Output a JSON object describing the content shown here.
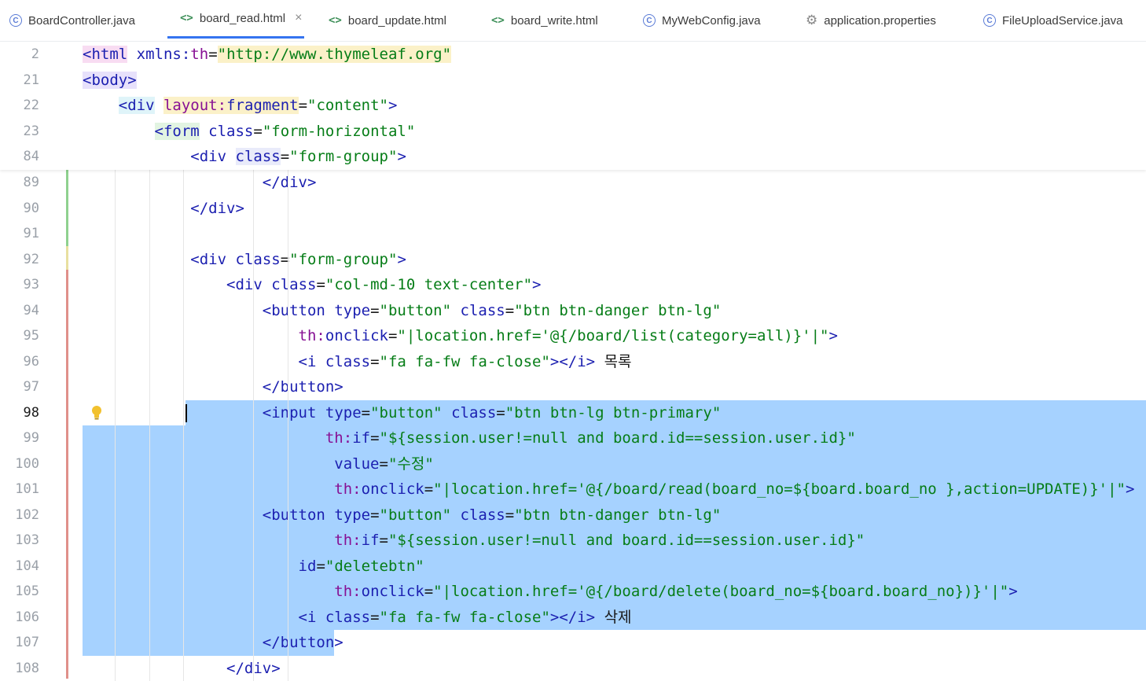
{
  "tabs": [
    {
      "label": "BoardController.java",
      "icon": "class-icon"
    },
    {
      "label": "board_read.html",
      "icon": "html-icon",
      "active": true
    },
    {
      "label": "board_update.html",
      "icon": "html-icon"
    },
    {
      "label": "board_write.html",
      "icon": "html-icon"
    },
    {
      "label": "MyWebConfig.java",
      "icon": "class-icon"
    },
    {
      "label": "application.properties",
      "icon": "gear-icon"
    },
    {
      "label": "FileUploadService.java",
      "icon": "class-icon"
    }
  ],
  "tab_close": "×",
  "sticky_lines": [
    {
      "num": "2",
      "text": "<html xmlns:th=\"http://www.thymeleaf.org\""
    },
    {
      "num": "21",
      "text": "<body>"
    },
    {
      "num": "22",
      "text": "    <div layout:fragment=\"content\">"
    },
    {
      "num": "23",
      "text": "        <form class=\"form-horizontal\""
    },
    {
      "num": "84",
      "text": "            <div class=\"form-group\">"
    }
  ],
  "lines": [
    {
      "num": "89",
      "text": "                    </div>"
    },
    {
      "num": "90",
      "text": "            </div>"
    },
    {
      "num": "91",
      "text": ""
    },
    {
      "num": "92",
      "text": "            <div class=\"form-group\">"
    },
    {
      "num": "93",
      "text": "                <div class=\"col-md-10 text-center\">"
    },
    {
      "num": "94",
      "text": "                    <button type=\"button\" class=\"btn btn-danger btn-lg\""
    },
    {
      "num": "95",
      "text": "                        th:onclick=\"|location.href='@{/board/list(category=all)}'|\">"
    },
    {
      "num": "96",
      "text": "                        <i class=\"fa fa-fw fa-close\"></i> 목록"
    },
    {
      "num": "97",
      "text": "                    </button>"
    },
    {
      "num": "98",
      "text": "                    <input type=\"button\" class=\"btn btn-lg btn-primary\""
    },
    {
      "num": "99",
      "text": "                           th:if=\"${session.user!=null and board.id==session.user.id}\""
    },
    {
      "num": "100",
      "text": "                            value=\"수정\""
    },
    {
      "num": "101",
      "text": "                            th:onclick=\"|location.href='@{/board/read(board_no=${board.board_no },action=UPDATE)}'|\">"
    },
    {
      "num": "102",
      "text": "                    <button type=\"button\" class=\"btn btn-danger btn-lg\""
    },
    {
      "num": "103",
      "text": "                            th:if=\"${session.user!=null and board.id==session.user.id}\""
    },
    {
      "num": "104",
      "text": "                        id=\"deletebtn\""
    },
    {
      "num": "105",
      "text": "                            th:onclick=\"|location.href='@{/board/delete(board_no=${board.board_no})}'|\">"
    },
    {
      "num": "106",
      "text": "                        <i class=\"fa fa-fw fa-close\"></i> 삭제"
    },
    {
      "num": "107",
      "text": "                    </button>"
    },
    {
      "num": "108",
      "text": "                </div>"
    }
  ],
  "colors": {
    "selection": "#a6d2ff",
    "tag": "#1b1fb0",
    "string": "#067d17",
    "th_attr": "#871094",
    "active_tab_underline": "#3574f0"
  }
}
